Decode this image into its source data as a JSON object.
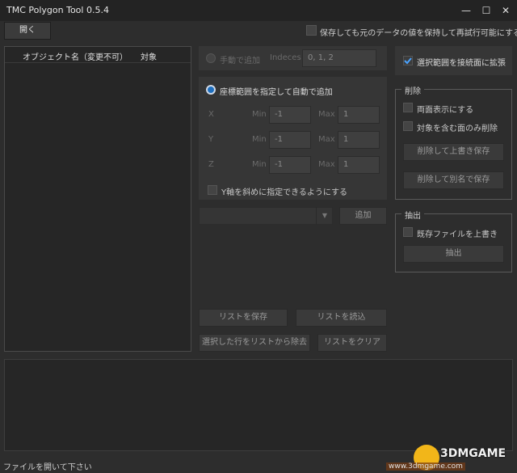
{
  "window": {
    "title": "TMC Polygon Tool 0.5.4",
    "minimize_glyph": "—",
    "maximize_glyph": "☐",
    "close_glyph": "✕"
  },
  "toolbar": {
    "open_label": "開く",
    "keep_values_label": "保存しても元のデータの値を保持して再試行可能にする"
  },
  "object_list": {
    "col_name": "オブジェクト名（変更不可）",
    "col_target": "対象"
  },
  "manual": {
    "label": "手動で追加",
    "indices_label": "Indeces",
    "indices_value": "0, 1, 2"
  },
  "auto": {
    "label": "座標範囲を指定して自動で追加",
    "rows": [
      {
        "axis": "X",
        "min_label": "Min",
        "min": "-1",
        "max_label": "Max",
        "max": "1"
      },
      {
        "axis": "Y",
        "min_label": "Min",
        "min": "-1",
        "max_label": "Max",
        "max": "1"
      },
      {
        "axis": "Z",
        "min_label": "Min",
        "min": "-1",
        "max_label": "Max",
        "max": "1"
      }
    ],
    "diagonal_label": "Y軸を斜めに指定できるようにする"
  },
  "add": {
    "combo_value": "",
    "add_label": "追加"
  },
  "list_buttons": {
    "save": "リストを保存",
    "load": "リストを読込",
    "remove_selected": "選択した行をリストから除去",
    "clear": "リストをクリア"
  },
  "right": {
    "expand_label": "選択範囲を接続面に拡張",
    "delete_group": {
      "title": "削除",
      "both_sides": "両面表示にする",
      "only_containing": "対象を含む面のみ削除",
      "overwrite_save": "削除して上書き保存",
      "save_as": "削除して別名で保存"
    },
    "extract_group": {
      "title": "抽出",
      "overwrite_existing": "既存ファイルを上書き",
      "extract_button": "抽出"
    }
  },
  "status": {
    "text": "ファイルを開いて下さい"
  },
  "watermark": {
    "text": "www.3dmgame.com",
    "brand": "3DMGAME"
  }
}
